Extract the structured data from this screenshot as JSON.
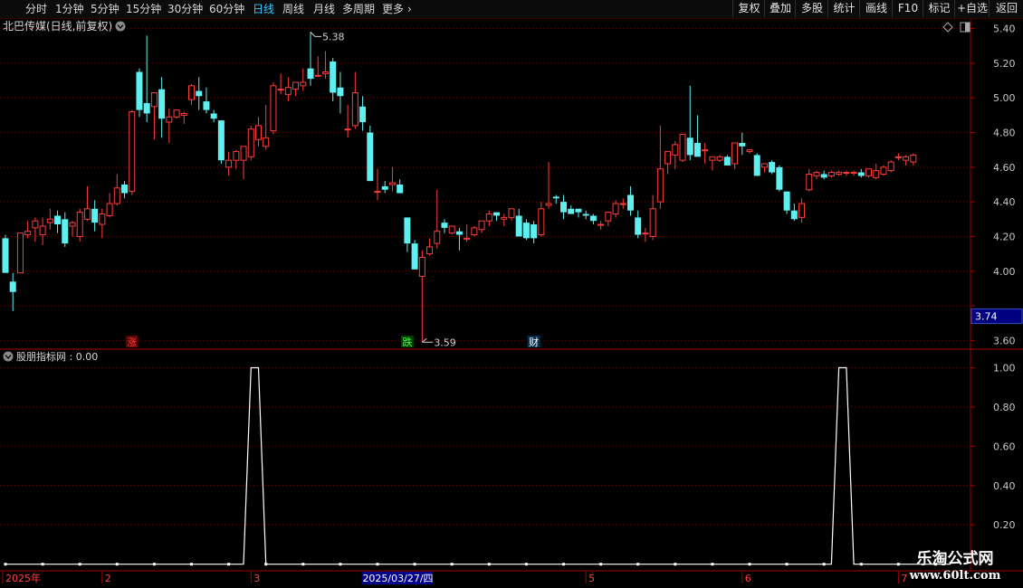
{
  "toolbar": {
    "periods": [
      {
        "label": "分时",
        "active": false
      },
      {
        "label": "1分钟",
        "active": false
      },
      {
        "label": "5分钟",
        "active": false
      },
      {
        "label": "15分钟",
        "active": false
      },
      {
        "label": "30分钟",
        "active": false
      },
      {
        "label": "60分钟",
        "active": false
      },
      {
        "label": "日线",
        "active": true
      },
      {
        "label": "周线",
        "active": false
      },
      {
        "label": "月线",
        "active": false
      },
      {
        "label": "多周期",
        "active": false
      },
      {
        "label": "更多",
        "active": false
      }
    ],
    "more_arrow": "›",
    "buttons": [
      "复权",
      "叠加",
      "多股",
      "统计",
      "画线",
      "F10",
      "标记",
      "+自选",
      "返回"
    ]
  },
  "main_panel": {
    "title": "北巴传媒(日线,前复权)",
    "chevron_icon": "chevron-down-icon",
    "tool_icons": [
      "diamond-icon",
      "window-toggle-icon"
    ]
  },
  "indicator_panel": {
    "title": "股朋指标网 : 0.00"
  },
  "chart_data": [
    {
      "type": "candlestick",
      "title": "北巴传媒(日线,前复权)",
      "y_ticks": [
        5.4,
        5.2,
        5.0,
        4.8,
        4.6,
        4.4,
        4.2,
        4.0,
        3.8,
        3.6
      ],
      "y_tick_labels": [
        "5.40",
        "5.20",
        "5.00",
        "4.80",
        "4.60",
        "4.40",
        "4.20",
        "4.00",
        "",
        "3.60"
      ],
      "ylim": [
        3.555,
        5.45
      ],
      "current_price_label": "3.74",
      "current_price": 3.74,
      "max_annotation": {
        "label": "5.38",
        "value": 5.38,
        "bar_index": 41
      },
      "min_annotation": {
        "label": "3.59",
        "value": 3.59,
        "bar_index": 56
      },
      "event_markers": [
        {
          "label": "涨",
          "bar_index": 17,
          "color": "#ff4040",
          "bg": "#5a0000"
        },
        {
          "label": "跌",
          "bar_index": 54,
          "color": "#40ff40",
          "bg": "#004000"
        },
        {
          "label": "财",
          "bar_index": 71,
          "color": "#ffffff",
          "bg": "#003050"
        }
      ],
      "up_color": "#ff3d3d",
      "down_color": "#5ef0f0",
      "ohlc": [
        [
          4.19,
          4.21,
          3.99,
          3.99
        ],
        [
          3.94,
          3.99,
          3.77,
          3.88
        ],
        [
          3.99,
          4.22,
          3.99,
          4.22
        ],
        [
          4.21,
          4.29,
          4.19,
          4.23
        ],
        [
          4.25,
          4.31,
          4.17,
          4.29
        ],
        [
          4.21,
          4.31,
          4.15,
          4.26
        ],
        [
          4.28,
          4.36,
          4.24,
          4.3
        ],
        [
          4.32,
          4.35,
          4.22,
          4.27
        ],
        [
          4.3,
          4.34,
          4.14,
          4.16
        ],
        [
          4.26,
          4.29,
          4.2,
          4.28
        ],
        [
          4.2,
          4.36,
          4.17,
          4.34
        ],
        [
          4.3,
          4.49,
          4.29,
          4.36
        ],
        [
          4.36,
          4.41,
          4.23,
          4.28
        ],
        [
          4.27,
          4.36,
          4.19,
          4.33
        ],
        [
          4.32,
          4.45,
          4.31,
          4.39
        ],
        [
          4.39,
          4.56,
          4.38,
          4.48
        ],
        [
          4.5,
          4.52,
          4.42,
          4.45
        ],
        [
          4.46,
          4.93,
          4.44,
          4.92
        ],
        [
          5.15,
          5.17,
          4.89,
          4.93
        ],
        [
          4.97,
          5.36,
          4.86,
          4.91
        ],
        [
          4.95,
          5.03,
          4.76,
          5.03
        ],
        [
          5.05,
          5.12,
          4.77,
          4.88
        ],
        [
          4.86,
          4.94,
          4.74,
          4.89
        ],
        [
          4.89,
          4.93,
          4.88,
          4.93
        ],
        [
          4.9,
          4.92,
          4.85,
          4.91
        ],
        [
          4.99,
          5.08,
          4.96,
          5.07
        ],
        [
          5.04,
          5.12,
          4.93,
          5.01
        ],
        [
          4.98,
          5.06,
          4.91,
          4.93
        ],
        [
          4.91,
          4.93,
          4.86,
          4.88
        ],
        [
          4.87,
          4.87,
          4.62,
          4.64
        ],
        [
          4.6,
          4.69,
          4.55,
          4.64
        ],
        [
          4.64,
          4.7,
          4.59,
          4.69
        ],
        [
          4.64,
          4.71,
          4.53,
          4.72
        ],
        [
          4.66,
          4.84,
          4.64,
          4.82
        ],
        [
          4.76,
          4.89,
          4.72,
          4.84
        ],
        [
          4.72,
          4.96,
          4.7,
          4.77
        ],
        [
          4.81,
          5.09,
          4.79,
          5.07
        ],
        [
          5.05,
          5.14,
          5.02,
          5.05
        ],
        [
          5.02,
          5.12,
          4.98,
          5.06
        ],
        [
          5.05,
          5.09,
          5.01,
          5.09
        ],
        [
          5.07,
          5.17,
          5.04,
          5.09
        ],
        [
          5.17,
          5.38,
          5.07,
          5.11
        ],
        [
          5.13,
          5.24,
          5.12,
          5.13
        ],
        [
          5.14,
          5.27,
          5.11,
          5.15
        ],
        [
          5.21,
          5.23,
          4.98,
          5.03
        ],
        [
          5.06,
          5.15,
          4.91,
          5.01
        ],
        [
          4.82,
          4.96,
          4.77,
          4.82
        ],
        [
          4.84,
          5.15,
          4.82,
          5.03
        ],
        [
          4.95,
          5.01,
          4.81,
          4.86
        ],
        [
          4.8,
          4.84,
          4.53,
          4.52
        ],
        [
          4.46,
          4.59,
          4.41,
          4.46
        ],
        [
          4.49,
          4.52,
          4.45,
          4.47
        ],
        [
          4.5,
          4.6,
          4.46,
          4.51
        ],
        [
          4.5,
          4.53,
          4.45,
          4.45
        ],
        [
          4.31,
          4.31,
          4.11,
          4.16
        ],
        [
          4.16,
          4.18,
          4.1,
          4.01
        ],
        [
          3.97,
          4.12,
          3.59,
          4.08
        ],
        [
          4.1,
          4.19,
          4.09,
          4.14
        ],
        [
          4.16,
          4.47,
          4.13,
          4.23
        ],
        [
          4.28,
          4.3,
          4.22,
          4.25
        ],
        [
          4.22,
          4.25,
          4.21,
          4.26
        ],
        [
          4.23,
          4.25,
          4.12,
          4.21
        ],
        [
          4.19,
          4.27,
          4.17,
          4.19
        ],
        [
          4.21,
          4.26,
          4.2,
          4.25
        ],
        [
          4.24,
          4.28,
          4.22,
          4.29
        ],
        [
          4.29,
          4.35,
          4.26,
          4.33
        ],
        [
          4.34,
          4.34,
          4.29,
          4.32
        ],
        [
          4.3,
          4.33,
          4.26,
          4.31
        ],
        [
          4.31,
          4.34,
          4.29,
          4.36
        ],
        [
          4.32,
          4.36,
          4.22,
          4.2
        ],
        [
          4.28,
          4.3,
          4.18,
          4.19
        ],
        [
          4.27,
          4.29,
          4.16,
          4.19
        ],
        [
          4.21,
          4.4,
          4.2,
          4.36
        ],
        [
          4.38,
          4.63,
          4.36,
          4.39
        ],
        [
          4.43,
          4.44,
          4.39,
          4.42
        ],
        [
          4.4,
          4.44,
          4.3,
          4.34
        ],
        [
          4.36,
          4.38,
          4.33,
          4.33
        ],
        [
          4.36,
          4.36,
          4.31,
          4.34
        ],
        [
          4.33,
          4.35,
          4.3,
          4.32
        ],
        [
          4.32,
          4.33,
          4.27,
          4.29
        ],
        [
          4.27,
          4.29,
          4.24,
          4.27
        ],
        [
          4.29,
          4.33,
          4.26,
          4.34
        ],
        [
          4.33,
          4.41,
          4.31,
          4.39
        ],
        [
          4.39,
          4.42,
          4.36,
          4.39
        ],
        [
          4.44,
          4.49,
          4.32,
          4.35
        ],
        [
          4.31,
          4.35,
          4.19,
          4.21
        ],
        [
          4.22,
          4.25,
          4.17,
          4.22
        ],
        [
          4.2,
          4.44,
          4.18,
          4.36
        ],
        [
          4.4,
          4.84,
          4.36,
          4.59
        ],
        [
          4.62,
          4.65,
          4.56,
          4.69
        ],
        [
          4.67,
          4.75,
          4.59,
          4.73
        ],
        [
          4.64,
          4.75,
          4.63,
          4.79
        ],
        [
          4.77,
          5.07,
          4.64,
          4.67
        ],
        [
          4.74,
          4.9,
          4.7,
          4.66
        ],
        [
          4.7,
          4.74,
          4.62,
          4.7
        ],
        [
          4.64,
          4.66,
          4.58,
          4.66
        ],
        [
          4.64,
          4.67,
          4.63,
          4.66
        ],
        [
          4.66,
          4.67,
          4.62,
          4.61
        ],
        [
          4.62,
          4.69,
          4.59,
          4.74
        ],
        [
          4.74,
          4.8,
          4.67,
          4.72
        ],
        [
          4.69,
          4.7,
          4.68,
          4.7
        ],
        [
          4.67,
          4.68,
          4.55,
          4.55
        ],
        [
          4.6,
          4.62,
          4.57,
          4.62
        ],
        [
          4.63,
          4.64,
          4.56,
          4.57
        ],
        [
          4.6,
          4.61,
          4.46,
          4.47
        ],
        [
          4.46,
          4.46,
          4.33,
          4.35
        ],
        [
          4.35,
          4.39,
          4.29,
          4.3
        ],
        [
          4.31,
          4.42,
          4.28,
          4.39
        ],
        [
          4.47,
          4.59,
          4.46,
          4.56
        ],
        [
          4.55,
          4.58,
          4.53,
          4.57
        ],
        [
          4.56,
          4.58,
          4.53,
          4.54
        ],
        [
          4.55,
          4.58,
          4.54,
          4.57
        ],
        [
          4.56,
          4.58,
          4.55,
          4.57
        ],
        [
          4.57,
          4.58,
          4.55,
          4.57
        ],
        [
          4.57,
          4.58,
          4.55,
          4.57
        ],
        [
          4.57,
          4.59,
          4.54,
          4.55
        ],
        [
          4.55,
          4.58,
          4.54,
          4.59
        ],
        [
          4.54,
          4.62,
          4.53,
          4.58
        ],
        [
          4.56,
          4.61,
          4.55,
          4.6
        ],
        [
          4.58,
          4.64,
          4.57,
          4.63
        ],
        [
          4.66,
          4.68,
          4.64,
          4.66
        ],
        [
          4.64,
          4.67,
          4.61,
          4.66
        ],
        [
          4.63,
          4.68,
          4.61,
          4.67
        ]
      ]
    },
    {
      "type": "line",
      "title": "股朋指标网 : 0.00",
      "y_ticks": [
        1.0,
        0.8,
        0.6,
        0.4,
        0.2
      ],
      "y_tick_labels": [
        "1.00",
        "0.80",
        "0.60",
        "0.40",
        "0.20"
      ],
      "ylim": [
        -0.02,
        1.03
      ],
      "line_color": "#ffffff",
      "values_on_bars": [
        0,
        0,
        0,
        0,
        0,
        0,
        0,
        0,
        0,
        0,
        0,
        0,
        0,
        0,
        0,
        0,
        0,
        0,
        0,
        0,
        0,
        0,
        0,
        0,
        0,
        0,
        0,
        0,
        0,
        0,
        0,
        0,
        0,
        1,
        1,
        0,
        0,
        0,
        0,
        0,
        0,
        0,
        0,
        0,
        0,
        0,
        0,
        0,
        0,
        0,
        0,
        0,
        0,
        0,
        0,
        0,
        0,
        0,
        0,
        0,
        0,
        0,
        0,
        0,
        0,
        0,
        0,
        0,
        0,
        0,
        0,
        0,
        0,
        0,
        0,
        0,
        0,
        0,
        0,
        0,
        0,
        0,
        0,
        0,
        0,
        0,
        0,
        0,
        0,
        0,
        0,
        0,
        0,
        0,
        0,
        0,
        0,
        0,
        0,
        0,
        0,
        0,
        0,
        0,
        0,
        0,
        0,
        0,
        0,
        0,
        0,
        0,
        1,
        1,
        0,
        0,
        0,
        0,
        0,
        0,
        0,
        0,
        0,
        0,
        0,
        0,
        0,
        0
      ],
      "x_axis_labels": [
        {
          "label": "2025年",
          "bar_index": 0
        },
        {
          "label": "2",
          "bar_index": 13
        },
        {
          "label": "3",
          "bar_index": 33
        },
        {
          "label": "2025/03/27/四",
          "bar_index": 52,
          "highlight": true
        },
        {
          "label": "5",
          "bar_index": 78
        },
        {
          "label": "6",
          "bar_index": 99
        },
        {
          "label": "7",
          "bar_index": 120
        }
      ]
    }
  ],
  "watermark": {
    "line1": "乐淘公式网",
    "line2": "www.60lt.com"
  }
}
